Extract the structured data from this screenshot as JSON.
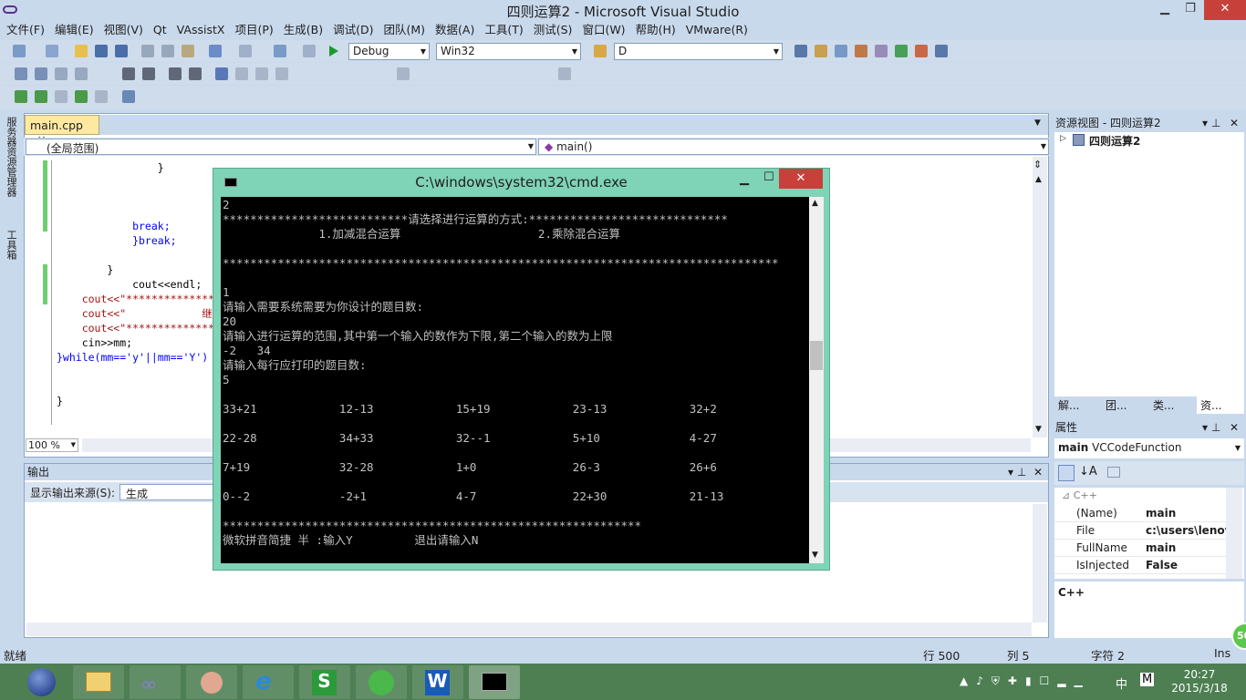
{
  "window": {
    "title": "四则运算2 - Microsoft Visual Studio",
    "min": "▁",
    "max": "❐",
    "close": "✕"
  },
  "menu": [
    "文件(F)",
    "编辑(E)",
    "视图(V)",
    "Qt",
    "VAssistX",
    "项目(P)",
    "生成(B)",
    "调试(D)",
    "团队(M)",
    "数据(A)",
    "工具(T)",
    "测试(S)",
    "窗口(W)",
    "帮助(H)",
    "VMware(R)"
  ],
  "toolbar": {
    "config": "Debug",
    "platform": "Win32",
    "find": "D"
  },
  "left_strip": {
    "server": "服务器资源管理器",
    "toolbox": "工具箱"
  },
  "editor": {
    "tab": "main.cpp",
    "tab_close": "✕",
    "scope": "(全局范围)",
    "func": "main()",
    "zoom": "100 %",
    "lines": [
      {
        "i": "                }",
        "t": "plain"
      },
      {
        "i": "",
        "t": "plain"
      },
      {
        "i": "",
        "t": "plain"
      },
      {
        "i": "",
        "t": "plain"
      },
      {
        "i": "            break;",
        "t": "kw"
      },
      {
        "i": "            }break;",
        "t": "kw"
      },
      {
        "i": "",
        "t": "plain"
      },
      {
        "i": "        }",
        "t": "plain"
      },
      {
        "i": "            cout<<endl;",
        "t": "plain"
      },
      {
        "i": "    cout<<\"**************",
        "t": "str"
      },
      {
        "i": "    cout<<\"            继",
        "t": "str"
      },
      {
        "i": "    cout<<\"**************",
        "t": "str"
      },
      {
        "i": "    cin>>mm;",
        "t": "plain"
      },
      {
        "i": "}while(mm=='y'||mm=='Y')",
        "t": "kw"
      },
      {
        "i": "",
        "t": "plain"
      },
      {
        "i": "",
        "t": "plain"
      },
      {
        "i": "}",
        "t": "plain"
      }
    ]
  },
  "output": {
    "title": "输出",
    "source_label": "显示输出来源(S):",
    "source_value": "生成"
  },
  "solution": {
    "title": "资源视图 - 四则运算2",
    "root": "四则运算2",
    "tabs": [
      "解...",
      "团...",
      "类...",
      "资..."
    ]
  },
  "properties": {
    "title": "属性",
    "object": "main",
    "object_type": "VCCodeFunction",
    "category": "C++",
    "rows": [
      [
        "(Name)",
        "main"
      ],
      [
        "File",
        "c:\\users\\lenov"
      ],
      [
        "FullName",
        "main"
      ],
      [
        "IsInjected",
        "False"
      ]
    ],
    "desc": "C++"
  },
  "status": {
    "ready": "就绪",
    "line": "行 500",
    "col": "列 5",
    "char": "字符 2",
    "ins": "Ins"
  },
  "cmd": {
    "title": "C:\\windows\\system32\\cmd.exe",
    "lines": [
      "2",
      "***************************请选择进行运算的方式:*****************************",
      "              1.加减混合运算                    2.乘除混合运算",
      "",
      "*********************************************************************************",
      "",
      "1",
      "请输入需要系统需要为你设计的题目数:",
      "20",
      "请输入进行运算的范围,其中第一个输入的数作为下限,第二个输入的数为上限",
      "-2   34",
      "请输入每行应打印的题目数:",
      "5",
      "",
      "33+21            12-13            15+19            23-13            32+2",
      "",
      "22-28            34+33            32--1            5+10             4-27",
      "",
      "7+19             32-28            1+0              26-3             26+6",
      "",
      "0--2             -2+1             4-7              22+30            21-13",
      "",
      "*************************************************************",
      "微软拼音简捷 半 :输入Y         退出请输入N"
    ]
  },
  "clock": {
    "time": "20:27",
    "date": "2015/3/18"
  },
  "tray": {
    "ime": "中",
    "m": "M"
  },
  "badge": "50"
}
